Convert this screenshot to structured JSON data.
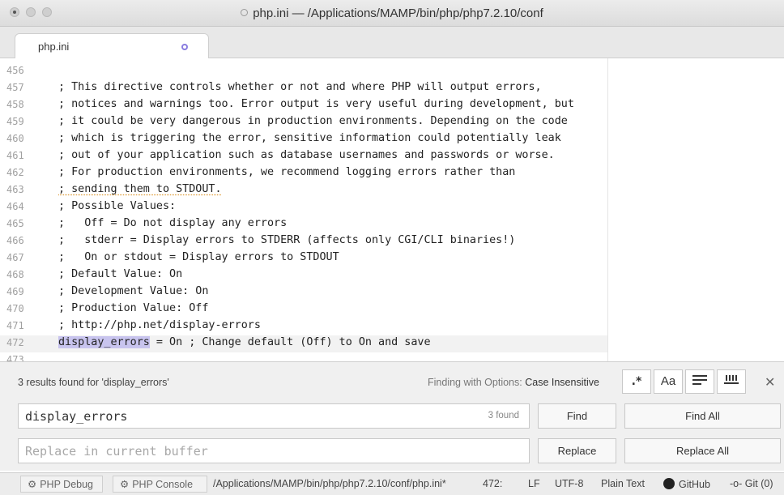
{
  "window": {
    "title": "php.ini — /Applications/MAMP/bin/php/php7.2.10/conf"
  },
  "tab": {
    "label": "php.ini"
  },
  "editor": {
    "lines": [
      {
        "no": "456",
        "text": ""
      },
      {
        "no": "457",
        "text": "; This directive controls whether or not and where PHP will output errors,"
      },
      {
        "no": "458",
        "text": "; notices and warnings too. Error output is very useful during development, but"
      },
      {
        "no": "459",
        "text": "; it could be very dangerous in production environments. Depending on the code"
      },
      {
        "no": "460",
        "text": "; which is triggering the error, sensitive information could potentially leak"
      },
      {
        "no": "461",
        "text": "; out of your application such as database usernames and passwords or worse."
      },
      {
        "no": "462",
        "text": "; For production environments, we recommend logging errors rather than"
      },
      {
        "no": "463",
        "text": "; sending them to STDOUT."
      },
      {
        "no": "464",
        "text": "; Possible Values:"
      },
      {
        "no": "465",
        "text": ";   Off = Do not display any errors"
      },
      {
        "no": "466",
        "text": ";   stderr = Display errors to STDERR (affects only CGI/CLI binaries!)"
      },
      {
        "no": "467",
        "text": ";   On or stdout = Display errors to STDOUT"
      },
      {
        "no": "468",
        "text": "; Default Value: On"
      },
      {
        "no": "469",
        "text": "; Development Value: On"
      },
      {
        "no": "470",
        "text": "; Production Value: Off"
      },
      {
        "no": "471",
        "text": "; http://php.net/display-errors"
      },
      {
        "no": "472",
        "text_match": "display_errors",
        "text_rest": " = On ; Change default (Off) to On and save"
      },
      {
        "no": "473",
        "text": ""
      }
    ]
  },
  "find": {
    "results_text": "3 results found for 'display_errors'",
    "options_prefix": "Finding with Options:",
    "options_value": "Case Insensitive",
    "opt_regex": ".*",
    "opt_case": "Aa",
    "find_value": "display_errors",
    "found_count": "3 found",
    "replace_placeholder": "Replace in current buffer",
    "find_label": "Find",
    "find_all_label": "Find All",
    "replace_label": "Replace",
    "replace_all_label": "Replace All",
    "close_glyph": "✕"
  },
  "status": {
    "php_debug": "PHP Debug",
    "php_console": "PHP Console",
    "path": "/Applications/MAMP/bin/php/php7.2.10/conf/php.ini*",
    "cursor": "472:",
    "line_ending": "LF",
    "encoding": "UTF-8",
    "grammar": "Plain Text",
    "github": "GitHub",
    "git": "Git (0)"
  },
  "colors": {
    "accent": "#8a7de0",
    "match_highlight": "#c8c4ee"
  }
}
